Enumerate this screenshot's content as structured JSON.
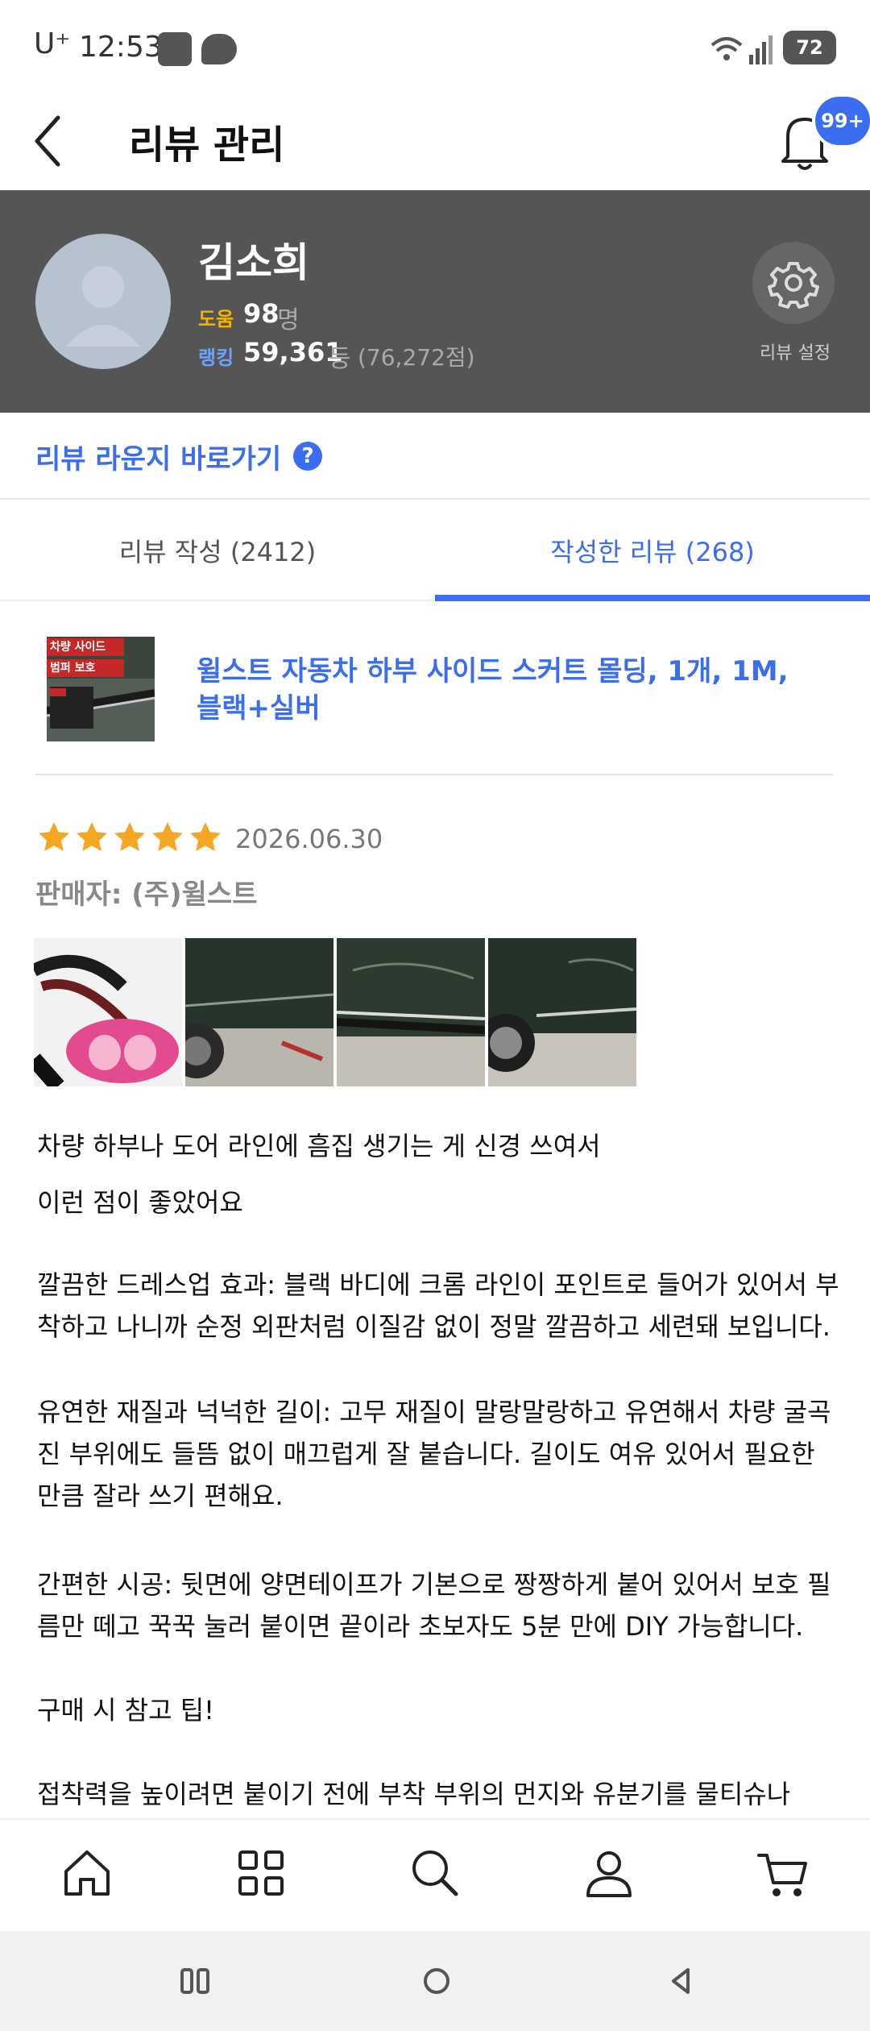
{
  "status_bar": {
    "carrier": "U⁺",
    "time": "12:53",
    "battery": "72"
  },
  "header": {
    "title": "리뷰 관리",
    "notification_badge": "99+"
  },
  "profile": {
    "name": "김소희",
    "help_label": "도움",
    "help_count": "98",
    "help_unit": "명",
    "rank_label": "랭킹",
    "rank_value": "59,361",
    "rank_unit": "등",
    "rank_score": "(76,272점)",
    "settings_label": "리뷰 설정"
  },
  "lounge_link": {
    "label": "리뷰 라운지 바로가기",
    "help_symbol": "?"
  },
  "tabs": [
    {
      "label": "리뷰 작성 (2412)",
      "active": false
    },
    {
      "label": "작성한 리뷰 (268)",
      "active": true
    }
  ],
  "product": {
    "thumb_tag1": "차량 사이드",
    "thumb_tag2": "범퍼 보호",
    "name": "윌스트 자동차 하부 사이드 스커트 몰딩, 1개, 1M, 블랙+실버"
  },
  "review": {
    "rating": 5,
    "date": "2026.06.30",
    "seller": "판매자: (주)윌스트",
    "photo_count": 4,
    "paragraphs": [
      "차량 하부나 도어 라인에 흠집 생기는 게 신경 쓰여서",
      " 이런 점이 좋았어요",
      "깔끔한 드레스업 효과: 블랙 바디에 크롬 라인이 포인트로 들어가 있어서 부착하고 나니까 순정 외판처럼 이질감 없이 정말 깔끔하고 세련돼 보입니다.",
      "유연한 재질과 넉넉한 길이: 고무 재질이 말랑말랑하고 유연해서 차량 굴곡진 부위에도 들뜸 없이 매끄럽게 잘 붙습니다. 길이도 여유 있어서 필요한 만큼 잘라 쓰기 편해요.",
      "간편한 시공: 뒷면에 양면테이프가 기본으로 짱짱하게 붙어 있어서 보호 필름만 떼고 꾹꾹 눌러 붙이면 끝이라 초보자도 5분 만에 DIY 가능합니다.",
      " 구매 시 참고 팁!",
      "접착력을 높이려면 붙이기 전에 부착 부위의 먼지와 유분기를 물티슈나"
    ]
  },
  "colors": {
    "accent": "#3a6df0",
    "profile_bg": "#555555",
    "star": "#f5a623"
  },
  "icons": {
    "back": "chevron-left-icon",
    "bell": "bell-icon",
    "settings": "gear-icon",
    "nav": [
      "home-icon",
      "grid-icon",
      "search-icon",
      "user-icon",
      "cart-icon"
    ]
  }
}
